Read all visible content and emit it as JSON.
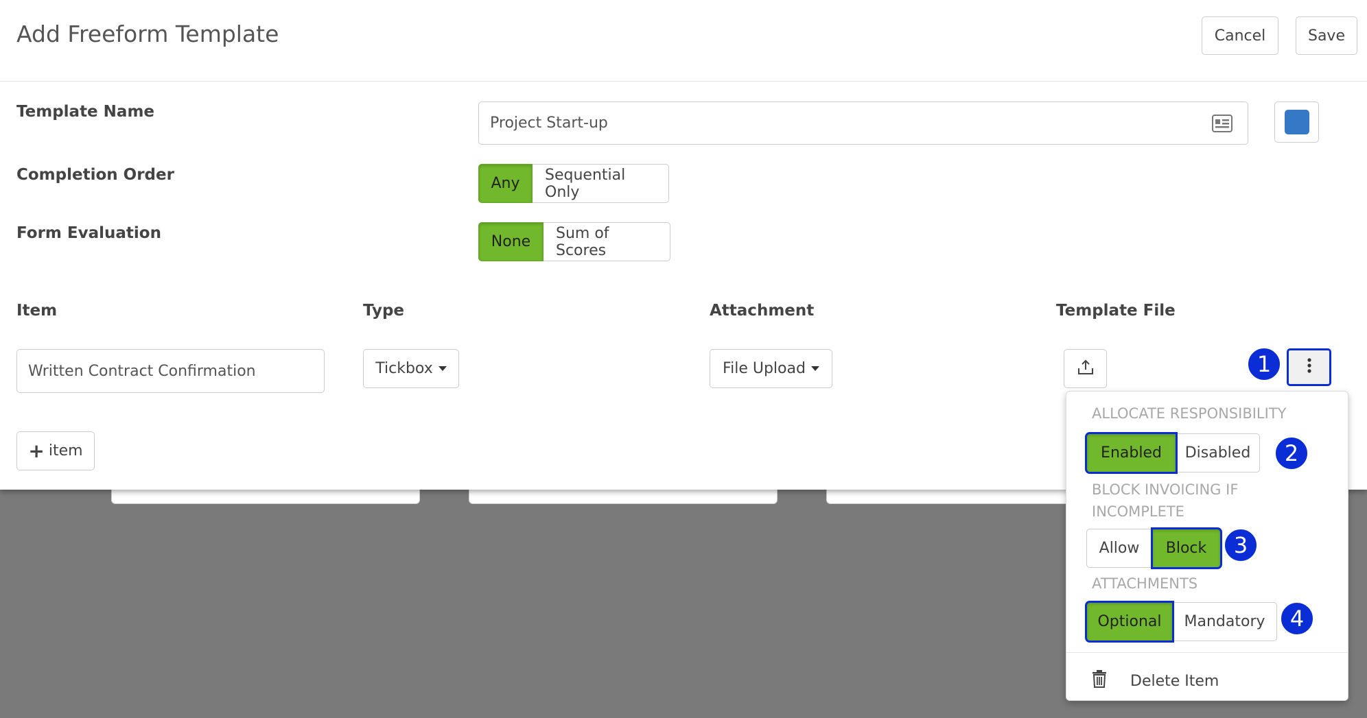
{
  "modal": {
    "title": "Add Freeform Template",
    "cancel_label": "Cancel",
    "save_label": "Save"
  },
  "form": {
    "template_name": {
      "label": "Template Name",
      "value": "Project Start-up"
    },
    "template_color": "#3478c6",
    "completion_order": {
      "label": "Completion Order",
      "options": [
        "Any",
        "Sequential Only"
      ],
      "selected": "Any"
    },
    "form_evaluation": {
      "label": "Form Evaluation",
      "options": [
        "None",
        "Sum of Scores"
      ],
      "selected": "None"
    }
  },
  "items_table": {
    "columns": [
      "Item",
      "Type",
      "Attachment",
      "Template File"
    ],
    "rows": [
      {
        "item": "Written Contract Confirmation",
        "type": "Tickbox",
        "attachment": "File Upload"
      }
    ],
    "add_item_label": "item"
  },
  "item_menu": {
    "allocate_responsibility": {
      "heading": "ALLOCATE RESPONSIBILITY",
      "options": [
        "Enabled",
        "Disabled"
      ],
      "selected": "Enabled"
    },
    "block_invoicing": {
      "heading": "BLOCK INVOICING IF INCOMPLETE",
      "options": [
        "Allow",
        "Block"
      ],
      "selected": "Block"
    },
    "attachments": {
      "heading": "ATTACHMENTS",
      "options": [
        "Optional",
        "Mandatory"
      ],
      "selected": "Optional"
    },
    "delete_label": "Delete Item"
  },
  "annotations": [
    "1",
    "2",
    "3",
    "4"
  ],
  "colors": {
    "accent_green": "#72b82c",
    "highlight_blue": "#0a2dd6"
  }
}
